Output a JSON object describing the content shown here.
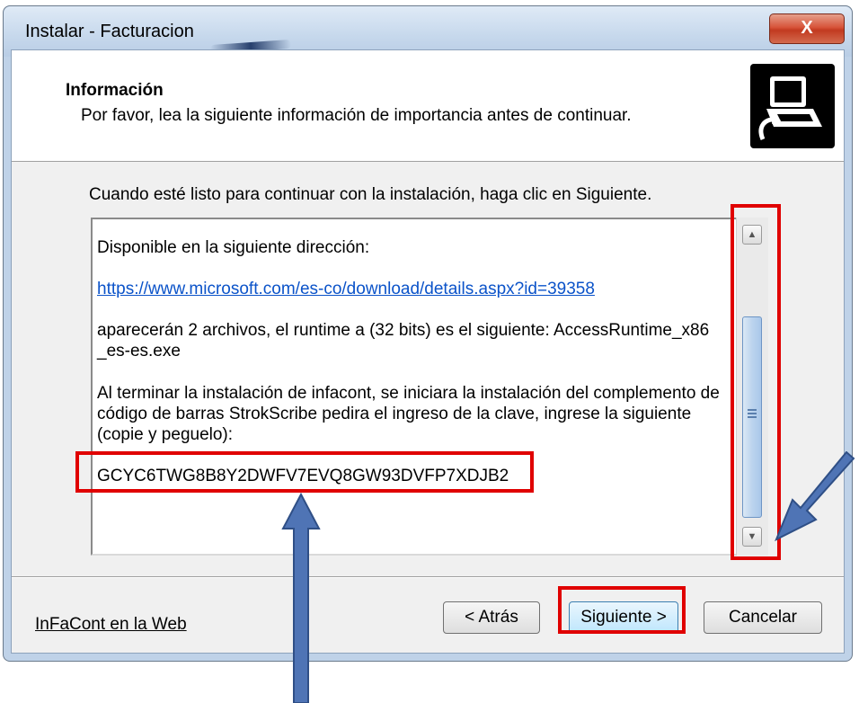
{
  "window": {
    "title": "Instalar - Facturacion",
    "close_label": "X"
  },
  "header": {
    "title": "Información",
    "subtitle": "Por favor, lea la siguiente información de importancia antes de continuar."
  },
  "intro_text": "Cuando esté listo para continuar con la instalación, haga clic en Siguiente.",
  "memo": {
    "line1": "Disponible en la siguiente dirección:",
    "link": "https://www.microsoft.com/es-co/download/details.aspx?id=39358",
    "para2_a": "aparecerán 2 archivos, el runtime a (32 bits) es el siguiente: AccessRuntime_x86",
    "para2_b": "_es-es.exe",
    "para3_a": "Al terminar la instalación de infacont, se iniciara la instalación del complemento de",
    "para3_b": "código de barras StrokScribe pedira el ingreso de la clave, ingrese la siguiente",
    "para3_c": "(copie y peguelo):",
    "key": "GCYC6TWG8B8Y2DWFV7EVQ8GW93DVFP7XDJB2"
  },
  "footer": {
    "web_link": "InFaCont en la Web",
    "back_label": "< Atrás",
    "next_label": "Siguiente >",
    "cancel_label": "Cancelar"
  },
  "colors": {
    "link": "#0b53c9",
    "annotation": "#e00000",
    "arrow": "#4f74b5"
  }
}
